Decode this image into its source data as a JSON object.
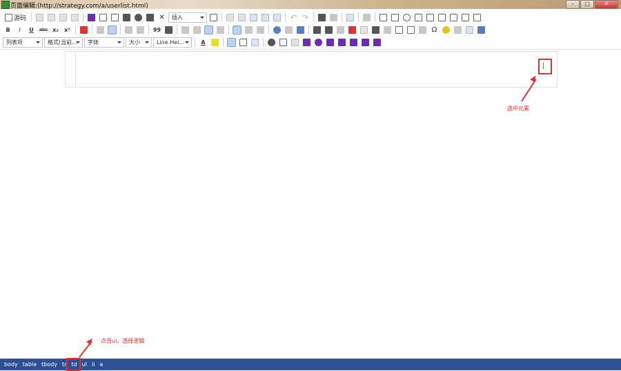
{
  "window": {
    "title": "页面编辑:(http://strategy.com/a/userlist.html)",
    "minimize": "–",
    "maximize": "□",
    "close": "✕"
  },
  "toolbar": {
    "source_label": "源码",
    "insert_combo": "插入",
    "list_combo": "列表项",
    "format_combo": "格式(当前...",
    "font_combo": "字体",
    "size_combo": "大小",
    "lineheight_combo": "Line Hei...",
    "bold": "B",
    "italic": "I",
    "underline": "U",
    "strike": "abc",
    "subscript": "x₂",
    "superscript": "x²",
    "quote": "99",
    "omega": "Ω",
    "text_color_glyph": "A"
  },
  "annotations": {
    "select_element": "选中元素",
    "click_ul": "点击ul，选择逻辑"
  },
  "statusbar": {
    "crumbs": [
      "body",
      "table",
      "tbody",
      "tr",
      "td",
      "ul",
      "li",
      "a"
    ]
  },
  "editor": {
    "caret": "|"
  }
}
